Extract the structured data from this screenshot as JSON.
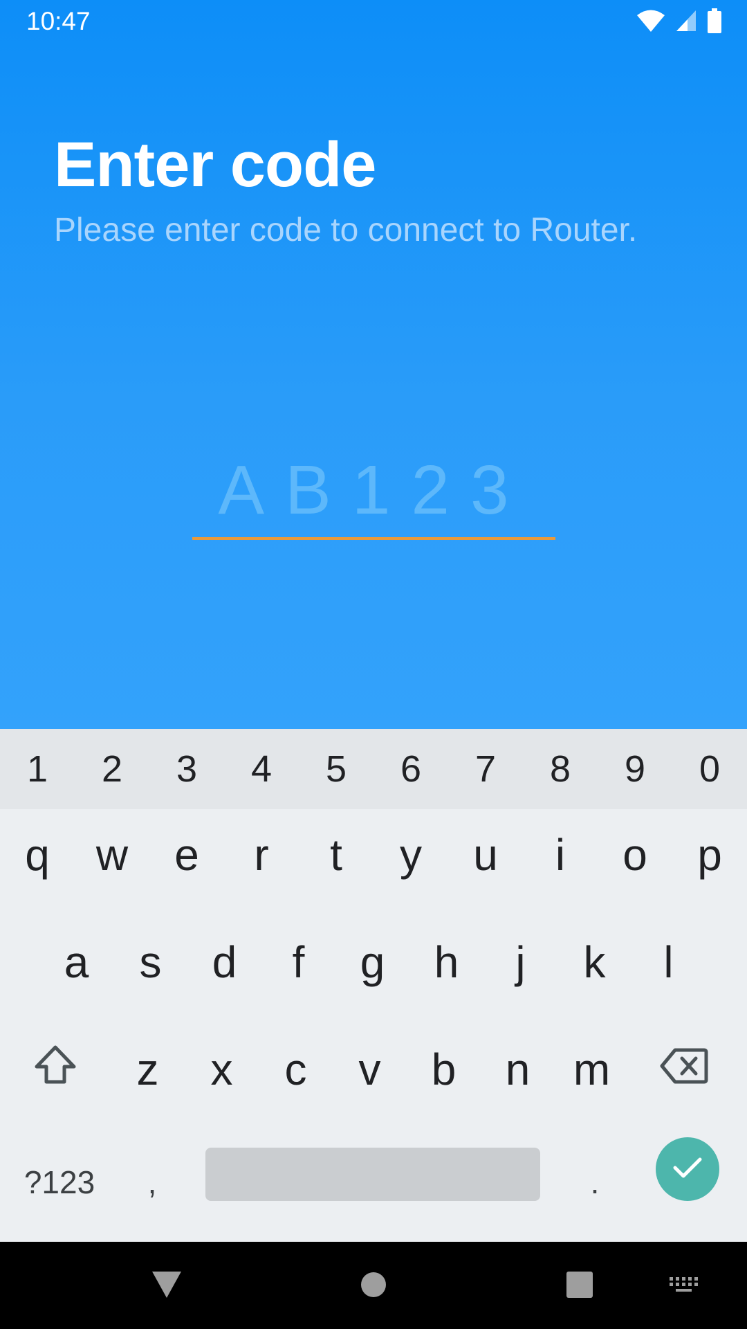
{
  "status_bar": {
    "time": "10:47",
    "icons": [
      "wifi-icon",
      "signal-icon",
      "battery-icon"
    ]
  },
  "header": {
    "title": "Enter code",
    "subtitle": "Please enter code to connect to Router."
  },
  "code_field": {
    "value": "",
    "placeholder": "AB123"
  },
  "keyboard": {
    "number_row": [
      "1",
      "2",
      "3",
      "4",
      "5",
      "6",
      "7",
      "8",
      "9",
      "0"
    ],
    "row1": [
      "q",
      "w",
      "e",
      "r",
      "t",
      "y",
      "u",
      "i",
      "o",
      "p"
    ],
    "row2": [
      "a",
      "s",
      "d",
      "f",
      "g",
      "h",
      "j",
      "k",
      "l"
    ],
    "row3": [
      "z",
      "x",
      "c",
      "v",
      "b",
      "n",
      "m"
    ],
    "symbols_label": "?123",
    "comma_label": ",",
    "period_label": ".",
    "shift_icon": "shift-icon",
    "backspace_icon": "backspace-icon",
    "enter_icon": "check-icon"
  },
  "navigation_bar": {
    "buttons": [
      "back-icon",
      "home-icon",
      "recents-icon",
      "keyboard-switch-icon"
    ]
  },
  "colors": {
    "app_background_top": "#0d8ef8",
    "app_background_bottom": "#33a2fb",
    "input_underline": "#e89a3c",
    "placeholder_text": "#5db8fb",
    "subtitle_text": "#a9d5fd",
    "keyboard_background": "#eceff2",
    "enter_key": "#4db6ac"
  }
}
